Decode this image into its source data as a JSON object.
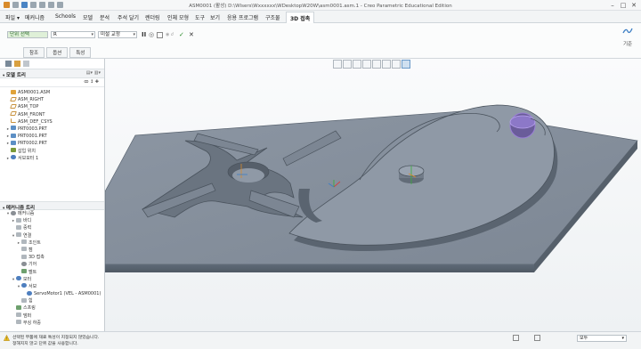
{
  "window": {
    "title": "ASM0001 (활성) D:\\Wlsers\\Wxxxxxx\\WDesktopW20W\\asm0001.asm.1 - Creo Parametric Educational Edition",
    "minimize": "–",
    "maximize": "□",
    "close": "✕"
  },
  "menu": {
    "tabs": [
      "파일 ▾",
      "메커니즘",
      "Schools",
      "모델",
      "분석",
      "주석 달기",
      "렌더링",
      "인체 모형",
      "도구",
      "보기",
      "응용 프로그램",
      "구조물",
      "3D 접촉"
    ],
    "active_tab": "3D 접촉"
  },
  "ribbon": {
    "selection_label": "단위 선택",
    "field_value": "R",
    "default_option": "미설 교정",
    "pause_label": "II",
    "stop_label": "◎",
    "ok_label": "✓",
    "cancel_label": "✕",
    "sub_tabs": [
      "참조",
      "옵션",
      "특성"
    ],
    "right_label": "기준"
  },
  "model_tree": {
    "header": "모델 트리",
    "items": [
      {
        "label": "ASM0001.ASM",
        "icon": "assembly-icon",
        "expand": ""
      },
      {
        "label": "ASM_RIGHT",
        "icon": "datum-plane-icon",
        "expand": ""
      },
      {
        "label": "ASM_TOP",
        "icon": "datum-plane-icon",
        "expand": ""
      },
      {
        "label": "ASM_FRONT",
        "icon": "datum-plane-icon",
        "expand": ""
      },
      {
        "label": "ASM_DEF_CSYS",
        "icon": "csys-icon",
        "expand": ""
      },
      {
        "label": "PRT0003.PRT",
        "icon": "part-icon",
        "expand": "▸"
      },
      {
        "label": "PRT0001.PRT",
        "icon": "part-icon",
        "expand": "▸"
      },
      {
        "label": "PRT0002.PRT",
        "icon": "part-icon",
        "expand": "▸"
      },
      {
        "label": "삽입 위치",
        "icon": "insert-icon",
        "expand": ""
      },
      {
        "label": "서보모터 1",
        "icon": "servo-motor-icon",
        "expand": "▸"
      }
    ]
  },
  "mechanism_tree": {
    "header": "메커니즘 트리",
    "items": [
      {
        "label": "메커니즘",
        "icon": "mechanism-icon",
        "expand": "▾",
        "indent": 0
      },
      {
        "label": "바디",
        "icon": "body-icon",
        "expand": "▸",
        "indent": 1
      },
      {
        "label": "중력",
        "icon": "gravity-icon",
        "expand": "",
        "indent": 1
      },
      {
        "label": "연결",
        "icon": "connection-icon",
        "expand": "▾",
        "indent": 1
      },
      {
        "label": "조인트",
        "icon": "joint-icon",
        "expand": "▸",
        "indent": 2
      },
      {
        "label": "캠",
        "icon": "cam-icon",
        "expand": "",
        "indent": 2
      },
      {
        "label": "3D 접촉",
        "icon": "contact-icon",
        "expand": "",
        "indent": 2
      },
      {
        "label": "기어",
        "icon": "gear-icon",
        "expand": "",
        "indent": 2
      },
      {
        "label": "벨트",
        "icon": "belt-icon",
        "expand": "",
        "indent": 2
      },
      {
        "label": "모터",
        "icon": "motor-icon",
        "expand": "▾",
        "indent": 1
      },
      {
        "label": "서보",
        "icon": "servo-icon",
        "expand": "▾",
        "indent": 2
      },
      {
        "label": "ServoMotor1 (VEL - ASM0001)",
        "icon": "servo-motor-icon",
        "expand": "",
        "indent": 3
      },
      {
        "label": "힘",
        "icon": "force-icon",
        "expand": "",
        "indent": 2
      },
      {
        "label": "스프링",
        "icon": "spring-icon",
        "expand": "",
        "indent": 1
      },
      {
        "label": "댐퍼",
        "icon": "damper-icon",
        "expand": "",
        "indent": 1
      },
      {
        "label": "부싱 하중",
        "icon": "bushing-icon",
        "expand": "",
        "indent": 1
      }
    ]
  },
  "status": {
    "line1": "선택된 부품에 재료 특성이 지정되지 않았습니다.",
    "line2": "정해지지 않고 단위 값을 사용합니다.",
    "filter_value": "모두"
  }
}
